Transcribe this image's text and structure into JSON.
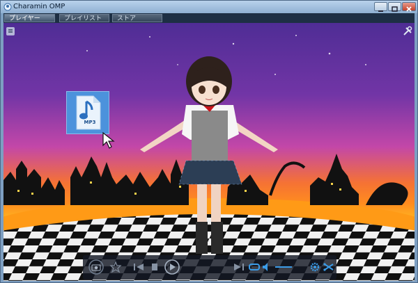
{
  "window": {
    "title": "Charamin OMP"
  },
  "tabs": [
    {
      "label": "プレイヤー"
    },
    {
      "label": "プレイリスト"
    },
    {
      "label": "ストア"
    }
  ],
  "drop_file": {
    "label": "MP3"
  },
  "colors": {
    "sky_top": "#4f2d95",
    "sky_mid": "#c347a8",
    "horizon": "#ff8c1f",
    "accent": "#3b9ce8"
  },
  "icons": [
    "app-icon",
    "minimize-icon",
    "maximize-icon",
    "close-icon",
    "menu-icon",
    "settings-icon",
    "music-file-icon",
    "mouse-pointer-icon",
    "camera-icon",
    "favorite-icon",
    "previous-icon",
    "stop-icon",
    "play-icon",
    "next-icon",
    "repeat-icon",
    "volume-icon",
    "gear-icon",
    "shuffle-icon"
  ]
}
